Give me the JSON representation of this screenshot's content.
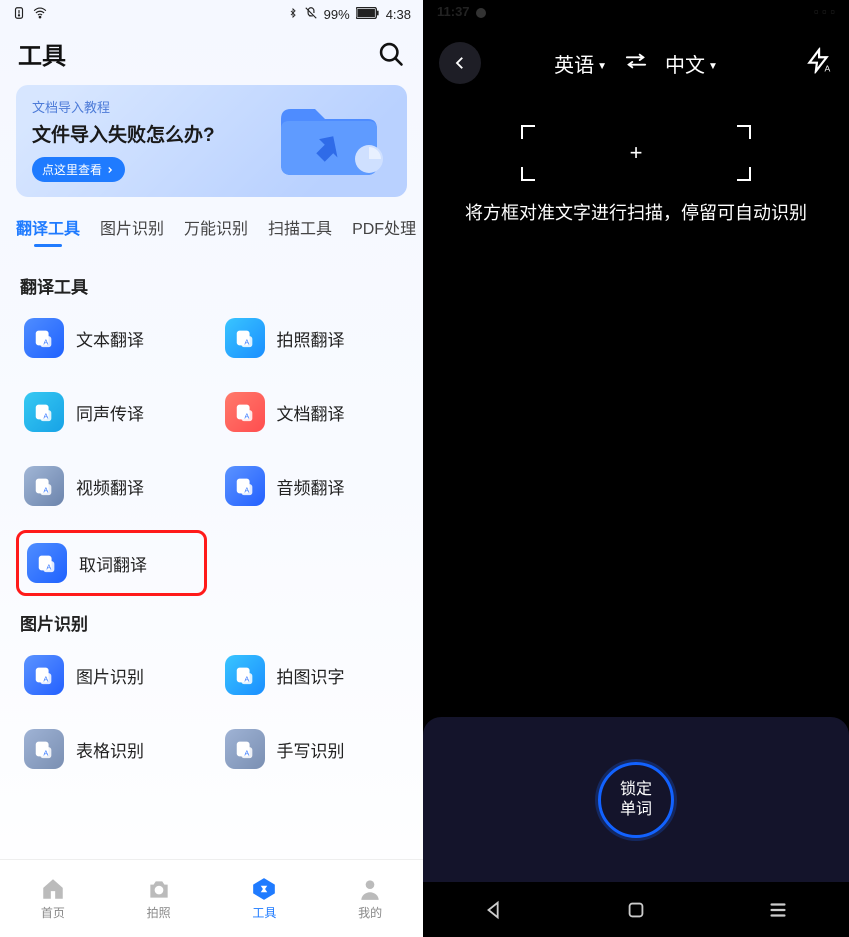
{
  "left": {
    "status": {
      "bluetooth": "✻",
      "mute": "✕",
      "battery_pct": "99%",
      "time": "4:38"
    },
    "page_title": "工具",
    "banner": {
      "subtitle": "文档导入教程",
      "title": "文件导入失败怎么办?",
      "button_label": "点这里查看"
    },
    "tabs": [
      "翻译工具",
      "图片识别",
      "万能识别",
      "扫描工具",
      "PDF处理"
    ],
    "active_tab_index": 0,
    "sections": {
      "translate": {
        "title": "翻译工具",
        "items": [
          {
            "label": "文本翻译",
            "icon_bg": "linear-gradient(135deg,#4f8dff,#1f62ff)",
            "name": "text-translate"
          },
          {
            "label": "拍照翻译",
            "icon_bg": "linear-gradient(135deg,#39c5ff,#1a8eff)",
            "name": "photo-translate"
          },
          {
            "label": "同声传译",
            "icon_bg": "linear-gradient(135deg,#37c9f2,#17a2e6)",
            "name": "realtime-translate"
          },
          {
            "label": "文档翻译",
            "icon_bg": "linear-gradient(135deg,#ff7a6b,#ff4d4f)",
            "name": "doc-translate"
          },
          {
            "label": "视频翻译",
            "icon_bg": "linear-gradient(135deg,#a1b6d6,#6c84ac)",
            "name": "video-translate"
          },
          {
            "label": "音频翻译",
            "icon_bg": "linear-gradient(135deg,#5b93ff,#2360ff)",
            "name": "audio-translate"
          },
          {
            "label": "取词翻译",
            "icon_bg": "linear-gradient(135deg,#4f8dff,#1f62ff)",
            "name": "word-pick-translate",
            "highlighted": true
          }
        ]
      },
      "image": {
        "title": "图片识别",
        "items": [
          {
            "label": "图片识别",
            "icon_bg": "linear-gradient(135deg,#5b93ff,#2360ff)",
            "name": "image-recognize"
          },
          {
            "label": "拍图识字",
            "icon_bg": "linear-gradient(135deg,#39c5ff,#1a8eff)",
            "name": "photo-to-text"
          },
          {
            "label": "表格识别",
            "icon_bg": "linear-gradient(135deg,#9fb3d5,#7a8fb2)",
            "name": "table-recognize"
          },
          {
            "label": "手写识别",
            "icon_bg": "linear-gradient(135deg,#9fb3d5,#7a8fb2)",
            "name": "handwriting-recognize"
          }
        ]
      }
    },
    "tabbar": [
      {
        "label": "首页",
        "name": "home"
      },
      {
        "label": "拍照",
        "name": "camera"
      },
      {
        "label": "工具",
        "name": "tools",
        "active": true
      },
      {
        "label": "我的",
        "name": "profile"
      }
    ]
  },
  "right": {
    "status": {
      "time": "11:37"
    },
    "lang_from": "英语",
    "lang_to": "中文",
    "hint": "将方框对准文字进行扫描，停留可自动识别",
    "lock_button_line1": "锁定",
    "lock_button_line2": "单词"
  }
}
